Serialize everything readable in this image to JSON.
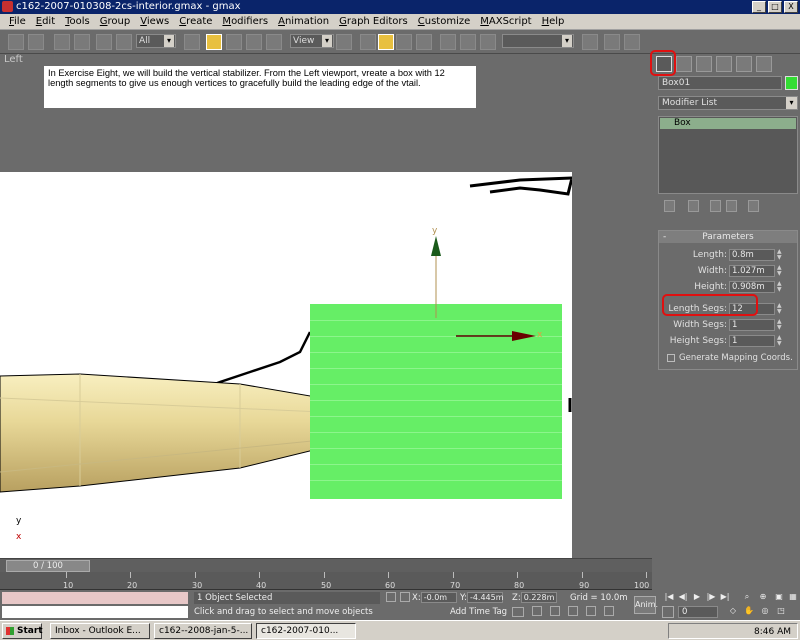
{
  "window": {
    "title": "c162-2007-010308-2cs-interior.gmax - gmax",
    "min": "_",
    "max": "□",
    "close": "X"
  },
  "menu": [
    "File",
    "Edit",
    "Tools",
    "Group",
    "Views",
    "Create",
    "Modifiers",
    "Animation",
    "Graph Editors",
    "Customize",
    "MAXScript",
    "Help"
  ],
  "toolbar": {
    "selection_filter": "All",
    "ref_coord": "View",
    "named_selection": ""
  },
  "viewport": {
    "label": "Left",
    "instruction": "In Exercise Eight, we will build the vertical stabilizer.  From the Left viewport, vreate a box with 12 length segments to give us enough vertices to gracefully build the leading edge of the vtail.",
    "gizmo_y": "y",
    "gizmo_x": "x",
    "corner_y": "y",
    "corner_x": "x"
  },
  "panel": {
    "object_name": "Box01",
    "modifier_list": "Modifier List",
    "stack_item": "Box",
    "rollout_title": "Parameters",
    "params": [
      {
        "label": "Length:",
        "value": "0.8m"
      },
      {
        "label": "Width:",
        "value": "1.027m"
      },
      {
        "label": "Height:",
        "value": "0.908m"
      },
      {
        "label": "Length Segs:",
        "value": "12"
      },
      {
        "label": "Width Segs:",
        "value": "1"
      },
      {
        "label": "Height Segs:",
        "value": "1"
      }
    ],
    "checkbox_label": "Generate Mapping Coords."
  },
  "time": {
    "slider": "0 / 100",
    "ticks": [
      "10",
      "20",
      "30",
      "40",
      "50",
      "60",
      "70",
      "80",
      "90",
      "100"
    ]
  },
  "status": {
    "selection": "1 Object Selected",
    "prompt": "Click and drag to select and move objects",
    "x_label": "X:",
    "x_value": "-0.0m",
    "y_label": "Y:",
    "y_value": "-4.445m",
    "z_label": "Z:",
    "z_value": "0.228m",
    "grid": "Grid = 10.0m",
    "add_time_tag": "Add Time Tag",
    "anim": "Anim.",
    "frame": "0"
  },
  "taskbar": {
    "start": "Start",
    "tasks": [
      "Inbox - Outlook E...",
      "c162--2008-jan-5-...",
      "c162-2007-010..."
    ],
    "clock": "8:46 AM"
  }
}
